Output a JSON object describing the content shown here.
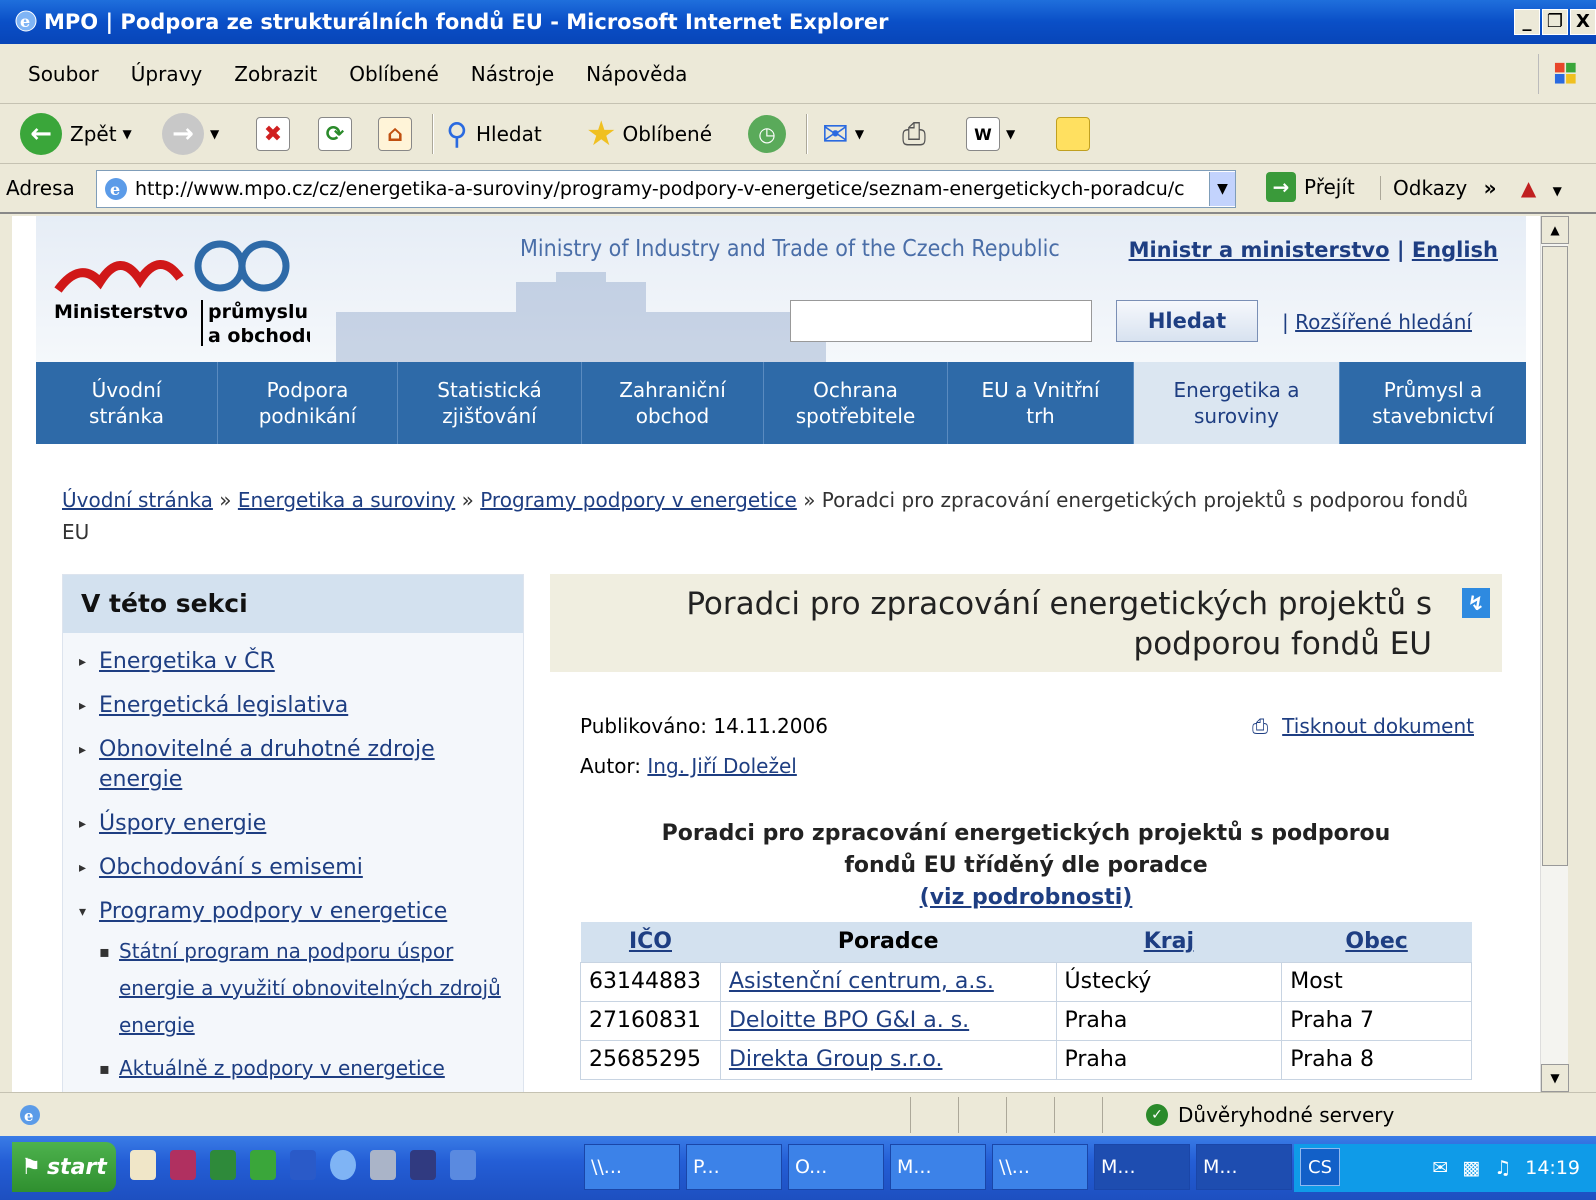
{
  "window": {
    "title": "MPO | Podpora ze strukturálních fondů EU - Microsoft Internet Explorer",
    "minimize": "_",
    "restore": "❐",
    "close": "X"
  },
  "menu": [
    "Soubor",
    "Úpravy",
    "Zobrazit",
    "Oblíbené",
    "Nástroje",
    "Nápověda"
  ],
  "toolbar": {
    "back": "Zpět",
    "search": "Hledat",
    "favorites": "Oblíbené"
  },
  "address": {
    "label": "Adresa",
    "url": "http://www.mpo.cz/cz/energetika-a-suroviny/programy-podpory-v-energetice/seznam-energetickych-poradcu/c",
    "go": "Přejít",
    "links": "Odkazy"
  },
  "site": {
    "logo_line1": "Ministerstvo",
    "logo_line2": "průmyslu",
    "logo_line3": "a obchodu",
    "ministry_en": "Ministry of Industry and Trade of the Czech Republic",
    "link_minister": "Ministr a ministerstvo",
    "link_sep": "|",
    "link_english": "English",
    "search_button": "Hledat",
    "search_value": "",
    "advanced_search": "Rozšířené hledání"
  },
  "nav": [
    {
      "line1": "Úvodní",
      "line2": "stránka"
    },
    {
      "line1": "Podpora",
      "line2": "podnikání"
    },
    {
      "line1": "Statistická",
      "line2": "zjišťování"
    },
    {
      "line1": "Zahraniční",
      "line2": "obchod"
    },
    {
      "line1": "Ochrana",
      "line2": "spotřebitele"
    },
    {
      "line1": "EU a Vnitřní",
      "line2": "trh"
    },
    {
      "line1": "Energetika a",
      "line2": "suroviny"
    },
    {
      "line1": "Průmysl a",
      "line2": "stavebnictví"
    }
  ],
  "breadcrumb": {
    "home": "Úvodní stránka",
    "sep": "»",
    "level1": "Energetika a suroviny",
    "level2": "Programy podpory v energetice",
    "current": "Poradci pro zpracování energetických projektů s podporou fondů EU"
  },
  "sidebar": {
    "title": "V této sekci",
    "items": [
      "Energetika v ČR",
      "Energetická legislativa",
      "Obnovitelné a druhotné zdroje energie",
      "Úspory energie",
      "Obchodování s emisemi",
      "Programy podpory v energetice"
    ],
    "subitems": [
      "Státní program na podporu úspor energie a využití obnovitelných zdrojů energie",
      "Aktuálně z podpory v energetice"
    ]
  },
  "article": {
    "title": "Poradci pro zpracování energetických projektů s podporou fondů EU",
    "published_label": "Publikováno:",
    "published_date": "14.11.2006",
    "author_label": "Autor:",
    "author": "Ing. Jiří Doležel",
    "print": "Tisknout dokument",
    "subtitle_line1": "Poradci pro zpracování energetických projektů s podporou",
    "subtitle_line2": "fondů EU tříděný dle poradce",
    "details_link": "(viz podrobnosti)"
  },
  "table": {
    "headers": [
      "IČO",
      "Poradce",
      "Kraj",
      "Obec"
    ],
    "rows": [
      [
        "63144883",
        "Asistenční centrum, a.s.",
        "Ústecký",
        "Most"
      ],
      [
        "27160831",
        "Deloitte BPO G&I a. s.",
        "Praha",
        "Praha 7"
      ],
      [
        "25685295",
        "Direkta Group s.r.o.",
        "Praha",
        "Praha 8"
      ]
    ]
  },
  "status": {
    "zone": "Důvěryhodné servery"
  },
  "taskbar": {
    "start": "start",
    "tasks": [
      "\\\\...",
      "P...",
      "O...",
      "M...",
      "\\\\...",
      "M...",
      "M..."
    ],
    "lang": "CS",
    "clock": "14:19"
  }
}
